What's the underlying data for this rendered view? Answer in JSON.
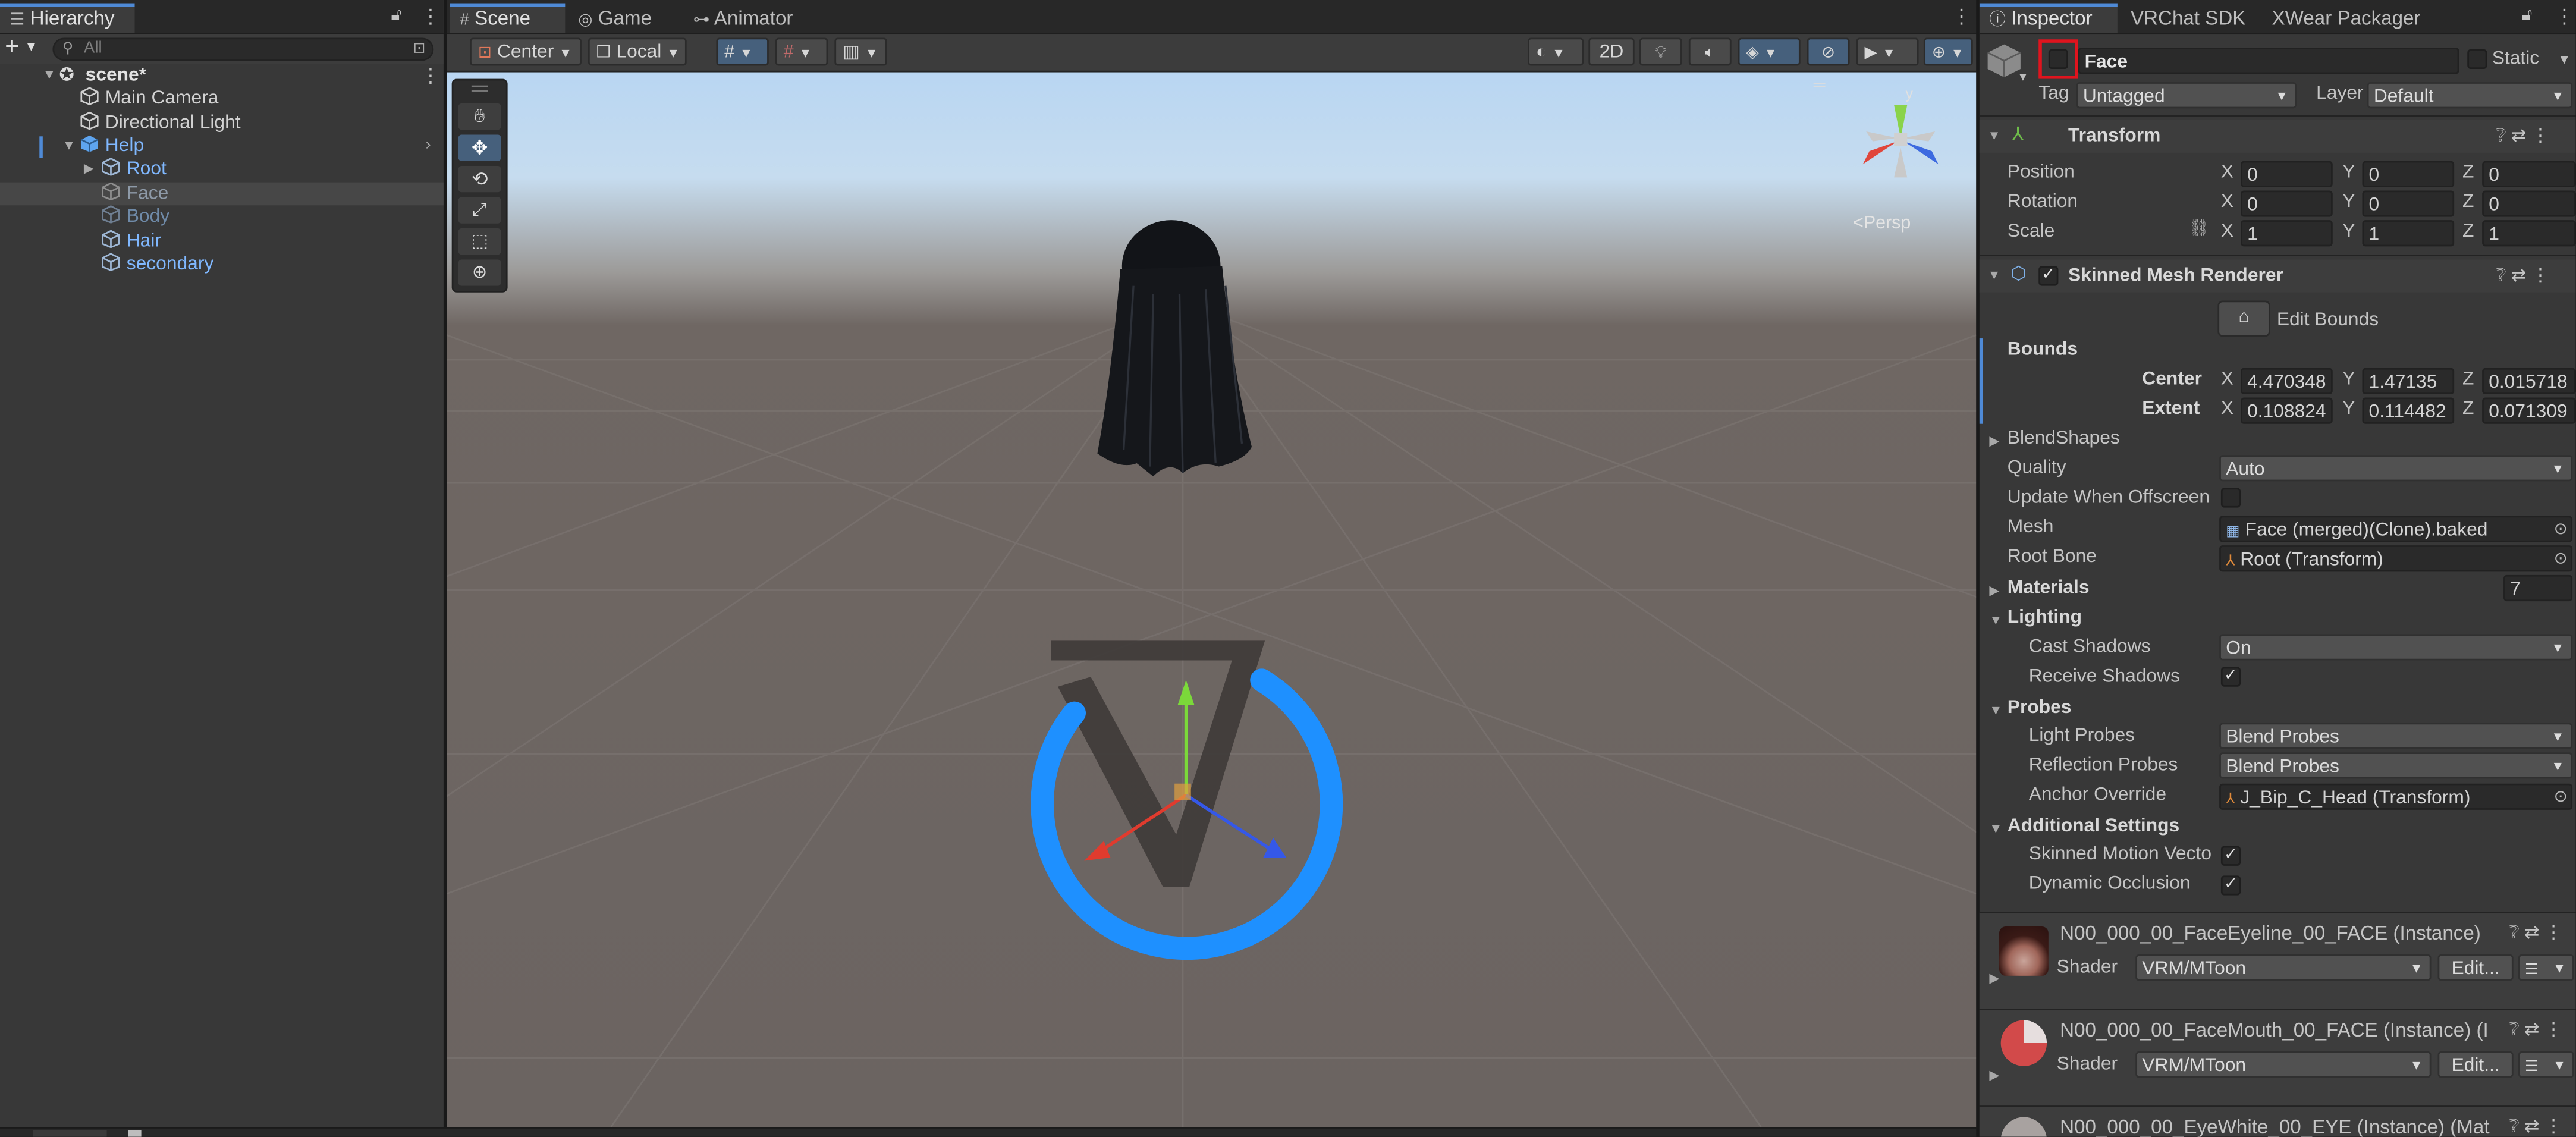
{
  "hierarchy": {
    "tab": "Hierarchy",
    "search_placeholder": "All",
    "scene": "scene*",
    "items": [
      {
        "label": "Main Camera"
      },
      {
        "label": "Directional Light"
      },
      {
        "label": "Help"
      },
      {
        "label": "Root"
      },
      {
        "label": "Face"
      },
      {
        "label": "Body"
      },
      {
        "label": "Hair"
      },
      {
        "label": "secondary"
      }
    ]
  },
  "scene_view": {
    "tabs": [
      "Scene",
      "Game",
      "Animator"
    ],
    "pivot_mode": "Center",
    "pivot_rotation": "Local",
    "mode_2d": "2D",
    "persp": "<Persp",
    "gizmo_axis_y": "y"
  },
  "inspector": {
    "tabs": [
      "Inspector",
      "VRChat SDK",
      "XWear Packager"
    ],
    "object_name": "Face",
    "static_label": "Static",
    "tag_label": "Tag",
    "tag_value": "Untagged",
    "layer_label": "Layer",
    "layer_value": "Default",
    "transform": {
      "title": "Transform",
      "position_label": "Position",
      "rotation_label": "Rotation",
      "scale_label": "Scale",
      "position": [
        "0",
        "0",
        "0"
      ],
      "rotation": [
        "0",
        "0",
        "0"
      ],
      "scale": [
        "1",
        "1",
        "1"
      ]
    },
    "axis": [
      "X",
      "Y",
      "Z"
    ],
    "smr": {
      "title": "Skinned Mesh Renderer",
      "edit_bounds": "Edit Bounds",
      "bounds": "Bounds",
      "center_label": "Center",
      "extent_label": "Extent",
      "center": [
        "4.470348",
        "1.47135",
        "0.015718"
      ],
      "extent": [
        "0.108824",
        "0.114482",
        "0.071309"
      ],
      "blendshapes": "BlendShapes",
      "quality_label": "Quality",
      "quality_value": "Auto",
      "update_offscreen": "Update When Offscreen",
      "mesh_label": "Mesh",
      "mesh_value": "Face (merged)(Clone).baked",
      "root_bone_label": "Root Bone",
      "root_bone_value": "Root (Transform)",
      "materials_label": "Materials",
      "materials_count": "7",
      "lighting": "Lighting",
      "cast_shadows_label": "Cast Shadows",
      "cast_shadows_value": "On",
      "receive_shadows_label": "Receive Shadows",
      "probes": "Probes",
      "light_probes_label": "Light Probes",
      "light_probes_value": "Blend Probes",
      "reflection_probes_label": "Reflection Probes",
      "reflection_probes_value": "Blend Probes",
      "anchor_override_label": "Anchor Override",
      "anchor_override_value": "J_Bip_C_Head (Transform)",
      "additional": "Additional Settings",
      "skinned_motion_label": "Skinned Motion Vecto",
      "dynamic_occlusion_label": "Dynamic Occlusion"
    },
    "materials": [
      {
        "name": "N00_000_00_FaceEyeline_00_FACE (Instance)",
        "shader": "VRM/MToon",
        "edit": "Edit..."
      },
      {
        "name": "N00_000_00_FaceMouth_00_FACE (Instance) (I",
        "shader": "VRM/MToon",
        "edit": "Edit..."
      },
      {
        "name": "N00_000_00_EyeWhite_00_EYE (Instance) (Mat",
        "shader": "",
        "edit": ""
      }
    ],
    "shader_label": "Shader"
  },
  "colors": {
    "accent": "#4f8ad6",
    "highlight_box": "#e0141e",
    "sky_top": "#b9d6f2",
    "ground": "#6f6763"
  }
}
